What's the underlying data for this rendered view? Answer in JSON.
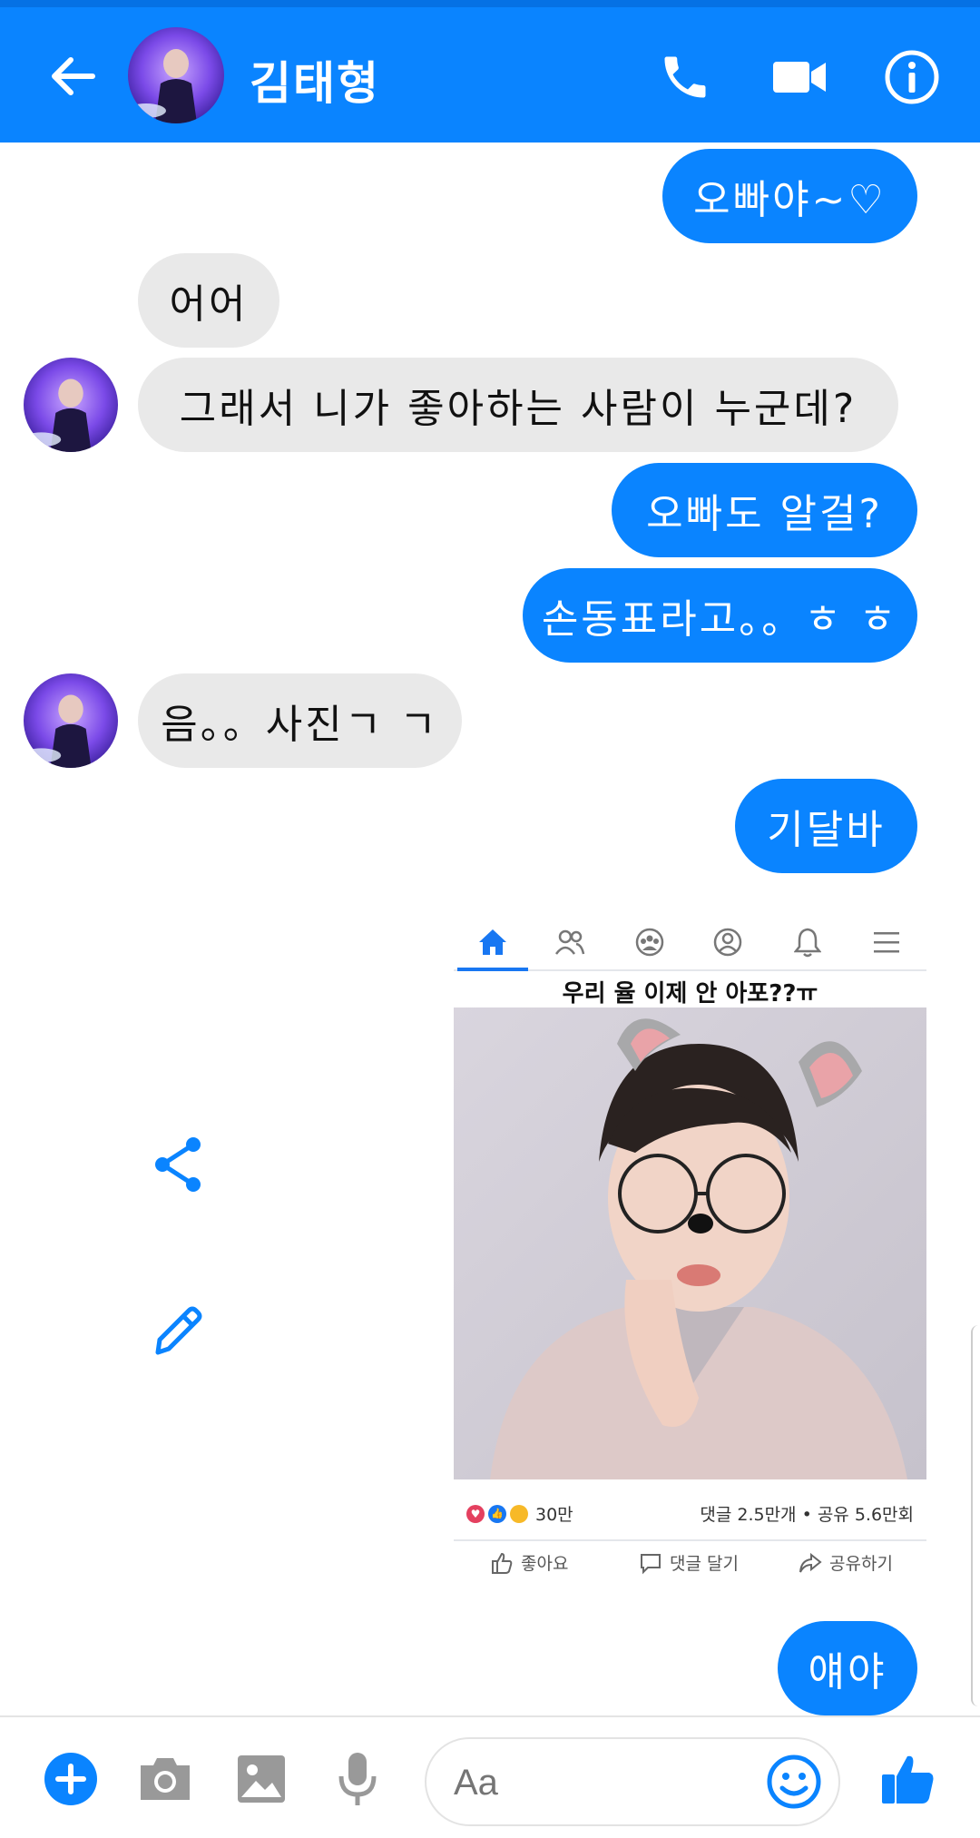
{
  "header": {
    "contact_name": "김태형"
  },
  "messages": [
    {
      "from": "me",
      "text": "오빠야~♡"
    },
    {
      "from": "them",
      "text": "어어"
    },
    {
      "from": "them",
      "text": "그래서 니가 좋아하는 사람이 누군데?"
    },
    {
      "from": "me",
      "text": "오빠도 알걸?"
    },
    {
      "from": "me",
      "text": "손동표라고。。ㅎ ㅎ"
    },
    {
      "from": "them",
      "text": "음。。사진ㄱ ㄱ"
    },
    {
      "from": "me",
      "text": "기달바"
    },
    {
      "from": "me",
      "text": "얘야"
    }
  ],
  "shared_post": {
    "caption": "우리 율 이제 안 아포??ㅠ",
    "reactions_count": "30만",
    "comments_shares": "댓글 2.5만개 • 공유 5.6만회",
    "actions": {
      "like": "좋아요",
      "comment": "댓글 달기",
      "share": "공유하기"
    }
  },
  "composer": {
    "placeholder": "Aa"
  },
  "colors": {
    "accent": "#0a84ff",
    "bubble_other": "#e9e9e9"
  }
}
